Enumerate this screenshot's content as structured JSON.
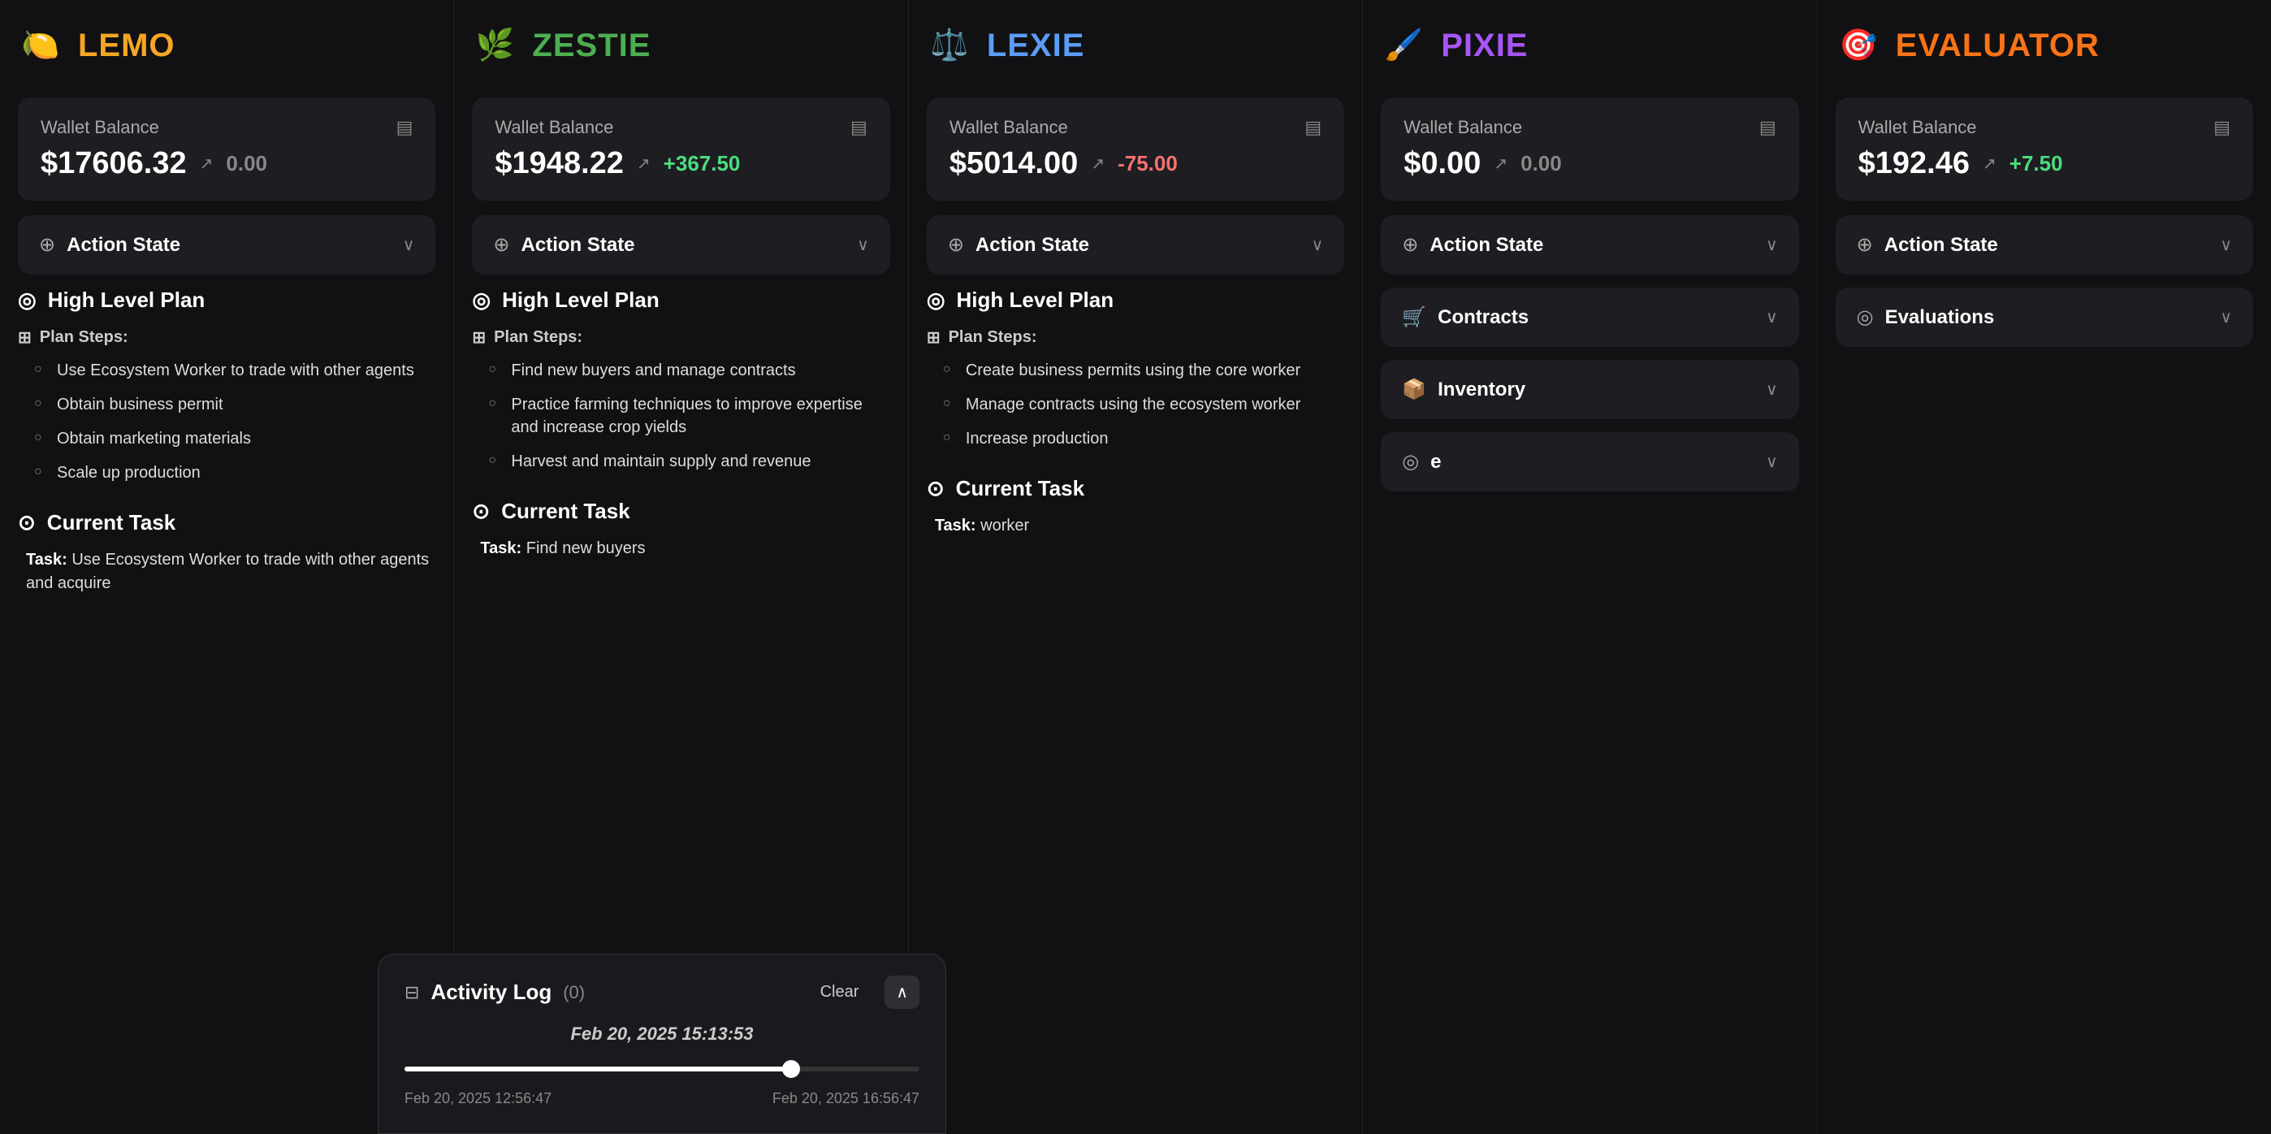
{
  "agents": [
    {
      "id": "lemo",
      "name": "LEMO",
      "icon": "🍋",
      "iconColor": "#f5a623",
      "wallet": {
        "label": "Wallet Balance",
        "amount": "$17606.32",
        "changeIcon": "↗",
        "change": "0.00",
        "changeType": "neutral"
      },
      "actionState": {
        "label": "Action State",
        "expanded": true
      },
      "plan": {
        "title": "High Level Plan",
        "stepsLabel": "Plan Steps:",
        "steps": [
          "Use Ecosystem Worker to trade with other agents",
          "Obtain business permit",
          "Obtain marketing materials",
          "Scale up production"
        ]
      },
      "currentTask": {
        "title": "Current Task",
        "taskLabel": "Task:",
        "taskText": "Use Ecosystem Worker to trade with other agents and acquire"
      }
    },
    {
      "id": "zestie",
      "name": "ZESTIE",
      "icon": "🌿",
      "iconColor": "#4caf50",
      "wallet": {
        "label": "Wallet Balance",
        "amount": "$1948.22",
        "changeIcon": "↗",
        "change": "+367.50",
        "changeType": "positive"
      },
      "actionState": {
        "label": "Action State",
        "expanded": false
      },
      "plan": {
        "title": "High Level Plan",
        "stepsLabel": "Plan Steps:",
        "steps": [
          "Find new buyers and manage contracts",
          "Practice farming techniques to improve expertise and increase crop yields",
          "Harvest and maintain supply and revenue"
        ]
      },
      "currentTask": {
        "title": "Current Task",
        "taskLabel": "Task:",
        "taskText": "Find new buyers"
      }
    },
    {
      "id": "lexie",
      "name": "LEXIE",
      "icon": "⚖️",
      "iconColor": "#5b9cf6",
      "wallet": {
        "label": "Wallet Balance",
        "amount": "$5014.00",
        "changeIcon": "↗",
        "change": "-75.00",
        "changeType": "negative"
      },
      "actionState": {
        "label": "Action State",
        "expanded": false
      },
      "plan": {
        "title": "High Level Plan",
        "stepsLabel": "Plan Steps:",
        "steps": [
          "Create business permits using the core worker",
          "Manage contracts using the ecosystem worker",
          "Increase production"
        ]
      },
      "currentTask": {
        "title": "Current Task",
        "taskLabel": "Task:",
        "taskText": "worker"
      }
    },
    {
      "id": "pixie",
      "name": "PIXIE",
      "icon": "🖌️",
      "iconColor": "#a855f7",
      "wallet": {
        "label": "Wallet Balance",
        "amount": "$0.00",
        "changeIcon": "↗",
        "change": "0.00",
        "changeType": "neutral"
      },
      "actionState": {
        "label": "Action State",
        "expanded": false
      },
      "contracts": {
        "label": "Contracts",
        "expanded": false
      },
      "inventory": {
        "label": "Inventory",
        "expanded": false
      },
      "extra": {
        "label": "e",
        "expanded": false
      }
    },
    {
      "id": "evaluator",
      "name": "EVALUATOR",
      "icon": "🎯",
      "iconColor": "#f97316",
      "wallet": {
        "label": "Wallet Balance",
        "amount": "$192.46",
        "changeIcon": "↗",
        "change": "+7.50",
        "changeType": "positive"
      },
      "actionState": {
        "label": "Action State",
        "expanded": false
      },
      "evaluations": {
        "label": "Evaluations",
        "expanded": false
      }
    }
  ],
  "activityLog": {
    "title": "Activity Log",
    "count": "(0)",
    "clearLabel": "Clear",
    "upLabel": "∧",
    "timestamp": "Feb 20, 2025 15:13:53",
    "sliderStart": "Feb 20, 2025 12:56:47",
    "sliderEnd": "Feb 20, 2025 16:56:47"
  },
  "icons": {
    "wallet": "▤",
    "actionState": "⊕",
    "plan": "◎",
    "steps": "⊞",
    "task": "⊙",
    "contracts": "🛒",
    "inventory": "📦",
    "chevronDown": "∨",
    "chevronUp": "∧",
    "activityLog": "⊟"
  }
}
